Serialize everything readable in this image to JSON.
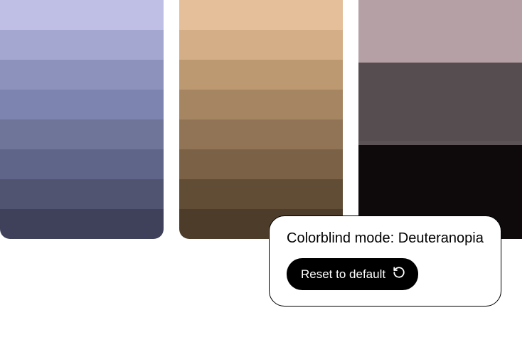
{
  "palettes": [
    {
      "swatches": [
        "#bfbfe6",
        "#a4a8d1",
        "#8c92bc",
        "#7e84b0",
        "#6f7499",
        "#5f6588",
        "#505471",
        "#3e4159"
      ]
    },
    {
      "swatches": [
        "#e4bf9a",
        "#d3ae86",
        "#bd9972",
        "#a68662",
        "#917455",
        "#7b6246",
        "#614d36",
        "#4d3c2a"
      ]
    },
    {
      "swatches": [
        "#b4a0a5",
        "#564d50",
        "#5c5356",
        "#0e0a0b"
      ]
    }
  ],
  "popup": {
    "title": "Colorblind mode: Deuteranopia",
    "button_label": "Reset to default"
  }
}
